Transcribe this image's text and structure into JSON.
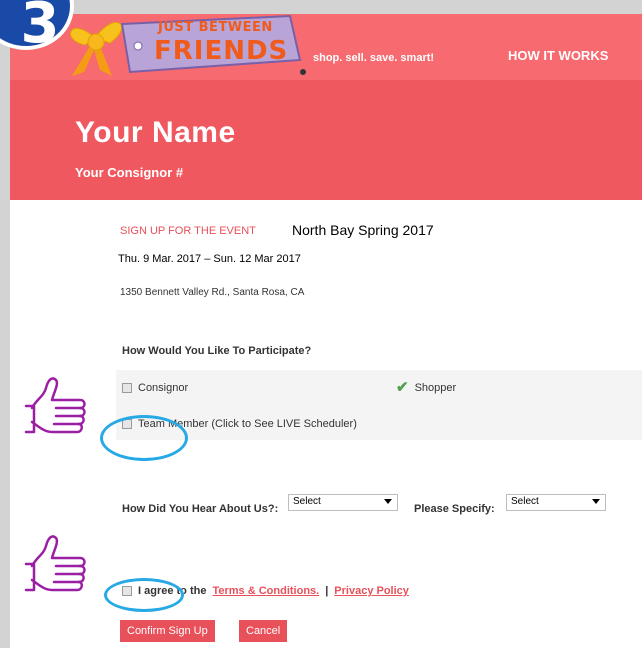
{
  "header": {
    "logo_line1": "JUST BETWEEN",
    "logo_line2": "FRIENDS",
    "tagline": "shop. sell. save. smart!",
    "nav_how_it_works": "HOW IT WORKS"
  },
  "annotation": {
    "step_number": "3"
  },
  "hero": {
    "name": "Your Name",
    "consignor": "Your Consignor #"
  },
  "event": {
    "signup_label": "SIGN UP FOR THE EVENT",
    "name": "North Bay Spring 2017",
    "dates": "Thu. 9 Mar. 2017 – Sun. 12 Mar 2017",
    "address": "1350 Bennett Valley Rd., Santa Rosa, CA"
  },
  "participate": {
    "title": "How Would You Like To Participate?",
    "options": [
      {
        "label": "Consignor",
        "checked": false
      },
      {
        "label": "Shopper",
        "checked": true
      },
      {
        "label": "Team Member (Click to See LIVE Scheduler)",
        "checked": false
      }
    ]
  },
  "hear": {
    "label": "How Did You Hear About Us?:",
    "select_value": "Select",
    "specify_label": "Please Specify:",
    "specify_value": "Select"
  },
  "agree": {
    "prefix": "I agree to the",
    "terms": "Terms & Conditions.",
    "separator": "|",
    "privacy": "Privacy Policy"
  },
  "buttons": {
    "confirm": "Confirm Sign Up",
    "cancel": "Cancel"
  },
  "colors": {
    "topbar": "#f76a70",
    "hero": "#f0585f",
    "accent": "#e8505a",
    "annotation_blue": "#27a9e6",
    "thumb_purple": "#9b1fa3"
  }
}
